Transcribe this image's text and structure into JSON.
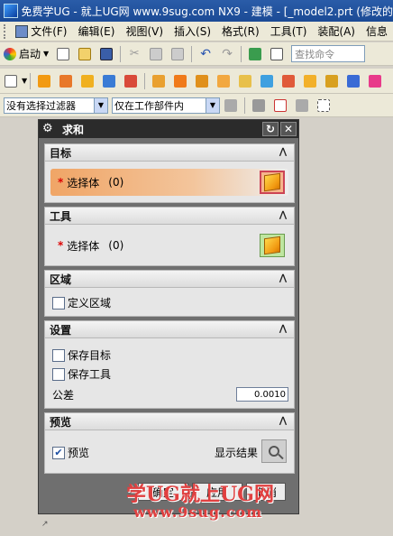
{
  "window": {
    "title": "免费学UG - 就上UG网 www.9sug.com  NX9 - 建模 - [_model2.prt  (修改的"
  },
  "menu": [
    "文件(F)",
    "编辑(E)",
    "视图(V)",
    "插入(S)",
    "格式(R)",
    "工具(T)",
    "装配(A)",
    "信息"
  ],
  "toolbar1": {
    "start_label": "启动",
    "search_placeholder": "查找命令"
  },
  "filters": {
    "selection_filter": "没有选择过滤器",
    "scope": "仅在工作部件内"
  },
  "dialog": {
    "title": "求和",
    "target": {
      "header": "目标",
      "select_label": "选择体",
      "count": "(0)"
    },
    "tool": {
      "header": "工具",
      "select_label": "选择体",
      "count": "(0)"
    },
    "region": {
      "header": "区域",
      "define_region": "定义区域",
      "define_region_checked": false
    },
    "settings": {
      "header": "设置",
      "keep_target": "保存目标",
      "keep_target_checked": false,
      "keep_tool": "保存工具",
      "keep_tool_checked": false,
      "tolerance_label": "公差",
      "tolerance_value": "0.0010"
    },
    "preview": {
      "header": "预览",
      "preview_label": "预览",
      "preview_checked": true,
      "show_result": "显示结果"
    },
    "buttons": {
      "ok": "确定",
      "apply": "应用",
      "cancel": "取消"
    }
  },
  "watermark": {
    "line1": "学UG就上UG网",
    "line2": "www.9sug.com"
  }
}
